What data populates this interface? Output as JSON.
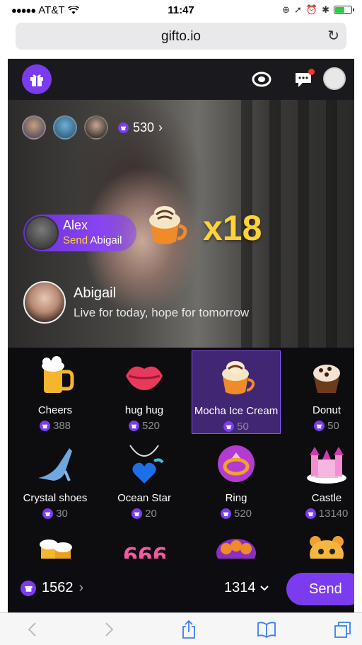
{
  "status_bar": {
    "carrier": "AT&T",
    "time": "11:47",
    "battery_level": 0.6
  },
  "browser": {
    "url": "gifto.io",
    "reload_icon": "reload-icon"
  },
  "header": {
    "logo_icon": "gift-icon",
    "icons": [
      "live-stream-icon",
      "chat-icon",
      "profile-avatar"
    ]
  },
  "stream": {
    "viewer_coins": "530",
    "gift_event": {
      "sender": "Alex",
      "action_verb": "Send",
      "recipient": "Abigail",
      "gift": "Mocha Ice Cream",
      "combo": "x18"
    },
    "host": {
      "name": "Abigail",
      "bio": "Live for today,  hope for tomorrow"
    }
  },
  "gifts": [
    {
      "name": "Cheers",
      "price": "388",
      "icon": "beer-mug-icon"
    },
    {
      "name": "hug hug",
      "price": "520",
      "icon": "lips-icon"
    },
    {
      "name": "Mocha Ice Cream",
      "price": "50",
      "icon": "mocha-cup-icon",
      "selected": true
    },
    {
      "name": "Donut",
      "price": "50",
      "icon": "cupcake-icon"
    },
    {
      "name": "Crystal shoes",
      "price": "30",
      "icon": "glass-slipper-icon"
    },
    {
      "name": "Ocean Star",
      "price": "20",
      "icon": "heart-necklace-icon"
    },
    {
      "name": "Ring",
      "price": "520",
      "icon": "ring-icon"
    },
    {
      "name": "Castle",
      "price": "13140",
      "icon": "castle-icon"
    }
  ],
  "more_gifts": [
    "beer-mugs-icon",
    "666-icon",
    "pumpkins-icon",
    "bear-icon"
  ],
  "footer": {
    "balance": "1562",
    "quantity": "1314",
    "send_label": "Send"
  },
  "colors": {
    "accent": "#7b3cf0",
    "combo": "#ffd23a"
  }
}
